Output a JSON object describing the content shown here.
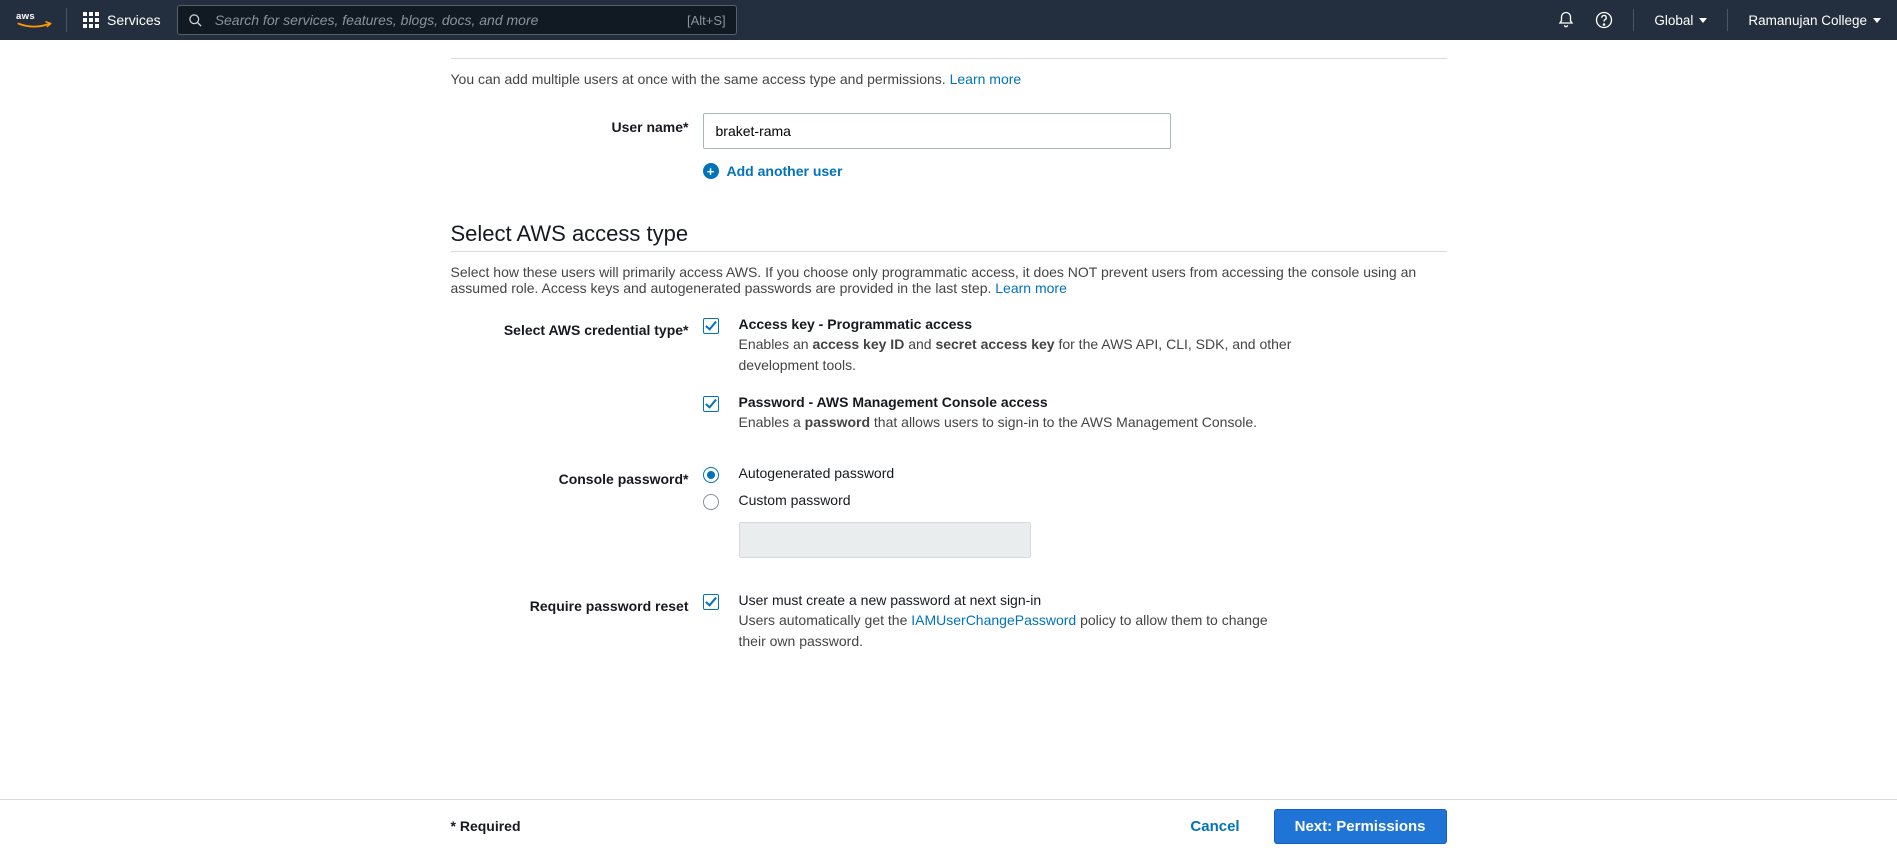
{
  "nav": {
    "services_label": "Services",
    "search_placeholder": "Search for services, features, blogs, docs, and more",
    "search_shortcut": "[Alt+S]",
    "region_label": "Global",
    "account_label": "Ramanujan College"
  },
  "section_users": {
    "helper_prefix": "You can add multiple users at once with the same access type and permissions. ",
    "learn_more": "Learn more",
    "username_label": "User name*",
    "username_value": "braket-rama",
    "add_another": "Add another user"
  },
  "section_access": {
    "title": "Select AWS access type",
    "helper_prefix": "Select how these users will primarily access AWS. If you choose only programmatic access, it does NOT prevent users from accessing the console using an assumed role. Access keys and autogenerated passwords are provided in the last step. ",
    "learn_more": "Learn more",
    "credential_label": "Select AWS credential type*",
    "cred_access_key": {
      "title": "Access key - Programmatic access",
      "desc_pre": "Enables an ",
      "desc_b1": "access key ID",
      "desc_mid": " and ",
      "desc_b2": "secret access key",
      "desc_post": " for the AWS API, CLI, SDK, and other development tools.",
      "checked": true
    },
    "cred_password": {
      "title": "Password - AWS Management Console access",
      "desc_pre": "Enables a ",
      "desc_b1": "password",
      "desc_post": " that allows users to sign-in to the AWS Management Console.",
      "checked": true
    },
    "console_pw_label": "Console password*",
    "console_pw_auto": "Autogenerated password",
    "console_pw_custom": "Custom password",
    "reset_label": "Require password reset",
    "reset_line1": "User must create a new password at next sign-in",
    "reset_line2_pre": "Users automatically get the ",
    "reset_link": "IAMUserChangePassword",
    "reset_line2_post": " policy to allow them to change their own password.",
    "reset_checked": true
  },
  "footer": {
    "required": "* Required",
    "cancel": "Cancel",
    "next": "Next: Permissions"
  }
}
